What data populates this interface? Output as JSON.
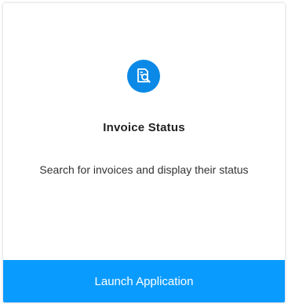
{
  "card": {
    "icon": "invoice-search-icon",
    "title": "Invoice Status",
    "description": "Search for invoices and display their status",
    "button_label": "Launch Application"
  },
  "colors": {
    "icon_background": "#0a8ae6",
    "button_background": "#0a9bff",
    "button_text": "#ffffff"
  }
}
